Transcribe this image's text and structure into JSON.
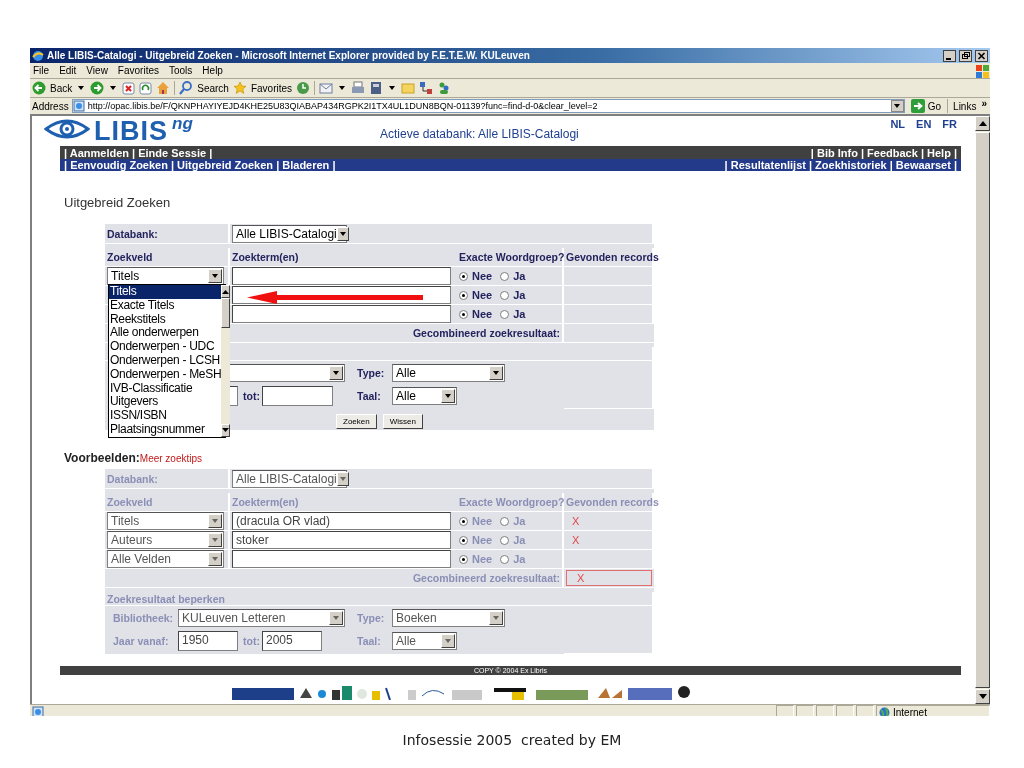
{
  "window": {
    "title": "Alle LIBIS-Catalogi - Uitgebreid Zoeken - Microsoft Internet Explorer provided by F.E.T.E.W. KULeuven"
  },
  "menu": [
    "File",
    "Edit",
    "View",
    "Favorites",
    "Tools",
    "Help"
  ],
  "toolbar": {
    "back": "Back",
    "search": "Search",
    "favorites": "Favorites"
  },
  "address": {
    "label": "Address",
    "url": "http://opac.libis.be/F/QKNPHAYIYEJD4KHE25U83QIABAP434RGPK2I1TX4UL1DUN8BQN-01139?func=find-d-0&clear_level=2",
    "go": "Go",
    "links": "Links",
    "more": "»"
  },
  "page": {
    "logo": "LIBIS",
    "logo_sup": "ng",
    "active_db": "Actieve databank: Alle LIBIS-Catalogi",
    "languages": [
      "NL",
      "EN",
      "FR"
    ],
    "bar_left": "| Aanmelden | Einde Sessie |",
    "bar_right": "| Bib Info | Feedback | Help |",
    "nav_left": "| Eenvoudig Zoeken | Uitgebreid Zoeken | Bladeren |",
    "nav_right": "| Resultatenlijst | Zoekhistoriek | Bewaarset |",
    "heading": "Uitgebreid Zoeken",
    "form": {
      "disabled": false,
      "databank_label": "Databank:",
      "databank": "Alle LIBIS-Catalogi",
      "columns": [
        "Zoekveld",
        "Zoekterm(en)",
        "Exacte Woordgroep?",
        "Gevonden records"
      ],
      "rows": [
        {
          "field": "Titels",
          "exact": [
            {
              "label": "Nee",
              "selected": true
            },
            {
              "label": "Ja",
              "selected": false
            }
          ]
        },
        {
          "exact": [
            {
              "label": "Nee",
              "selected": true
            },
            {
              "label": "Ja",
              "selected": false
            }
          ]
        },
        {
          "exact": [
            {
              "label": "Nee",
              "selected": true
            },
            {
              "label": "Ja",
              "selected": false
            }
          ]
        }
      ],
      "combined_label": "Gecombineerd zoekresultaat:",
      "limit": {
        "type_label": "Type:",
        "type": "Alle",
        "to_label": "tot:",
        "lang_label": "Taal:",
        "lang": "Alle"
      },
      "buttons": [
        "Zoeken",
        "Wissen"
      ]
    },
    "examples_label": "Voorbeelden:",
    "tips_link": "Meer zoektips",
    "example_form": {
      "disabled": true,
      "databank_label": "Databank:",
      "databank": "Alle LIBIS-Catalogi",
      "columns": [
        "Zoekveld",
        "Zoekterm(en)",
        "Exacte Woordgroep?",
        "Gevonden records"
      ],
      "rows": [
        {
          "field": "Titels",
          "term": "(dracula OR vlad)",
          "exact": [
            {
              "label": "Nee",
              "selected": true
            },
            {
              "label": "Ja",
              "selected": false
            }
          ],
          "result": "X"
        },
        {
          "field": "Auteurs",
          "term": "stoker",
          "exact": [
            {
              "label": "Nee",
              "selected": true
            },
            {
              "label": "Ja",
              "selected": false
            }
          ],
          "result": "X"
        },
        {
          "field": "Alle Velden",
          "exact": [
            {
              "label": "Nee",
              "selected": true
            },
            {
              "label": "Ja",
              "selected": false
            }
          ]
        }
      ],
      "combined_label": "Gecombineerd zoekresultaat:",
      "combined_result": "X",
      "limit": {
        "header": "Zoekresultaat beperken",
        "library_label": "Bibliotheek:",
        "library": "KULeuven Letteren",
        "type_label": "Type:",
        "type": "Boeken",
        "year_label": "Jaar vanaf:",
        "from": "1950",
        "to_label": "tot:",
        "to": "2005",
        "lang_label": "Taal:",
        "lang": "Alle"
      }
    },
    "copyright": "COPY © 2004 Ex Libris"
  },
  "dropdown": {
    "options": [
      {
        "label": "Titels",
        "selected": true
      },
      {
        "label": "Exacte Titels",
        "selected": false
      },
      {
        "label": "Reekstitels",
        "selected": false
      },
      {
        "label": "Alle onderwerpen",
        "selected": false
      },
      {
        "label": "Onderwerpen - UDC",
        "selected": false
      },
      {
        "label": "Onderwerpen - LCSH",
        "selected": false
      },
      {
        "label": "Onderwerpen - MeSH",
        "selected": false
      },
      {
        "label": "IVB-Classificatie",
        "selected": false
      },
      {
        "label": "Uitgevers",
        "selected": false
      },
      {
        "label": "ISSN/ISBN",
        "selected": false
      },
      {
        "label": "Plaatsingsnummer",
        "selected": false
      }
    ]
  },
  "status": {
    "zone": "Internet"
  },
  "caption": "Infosessie 2005  created by EM"
}
